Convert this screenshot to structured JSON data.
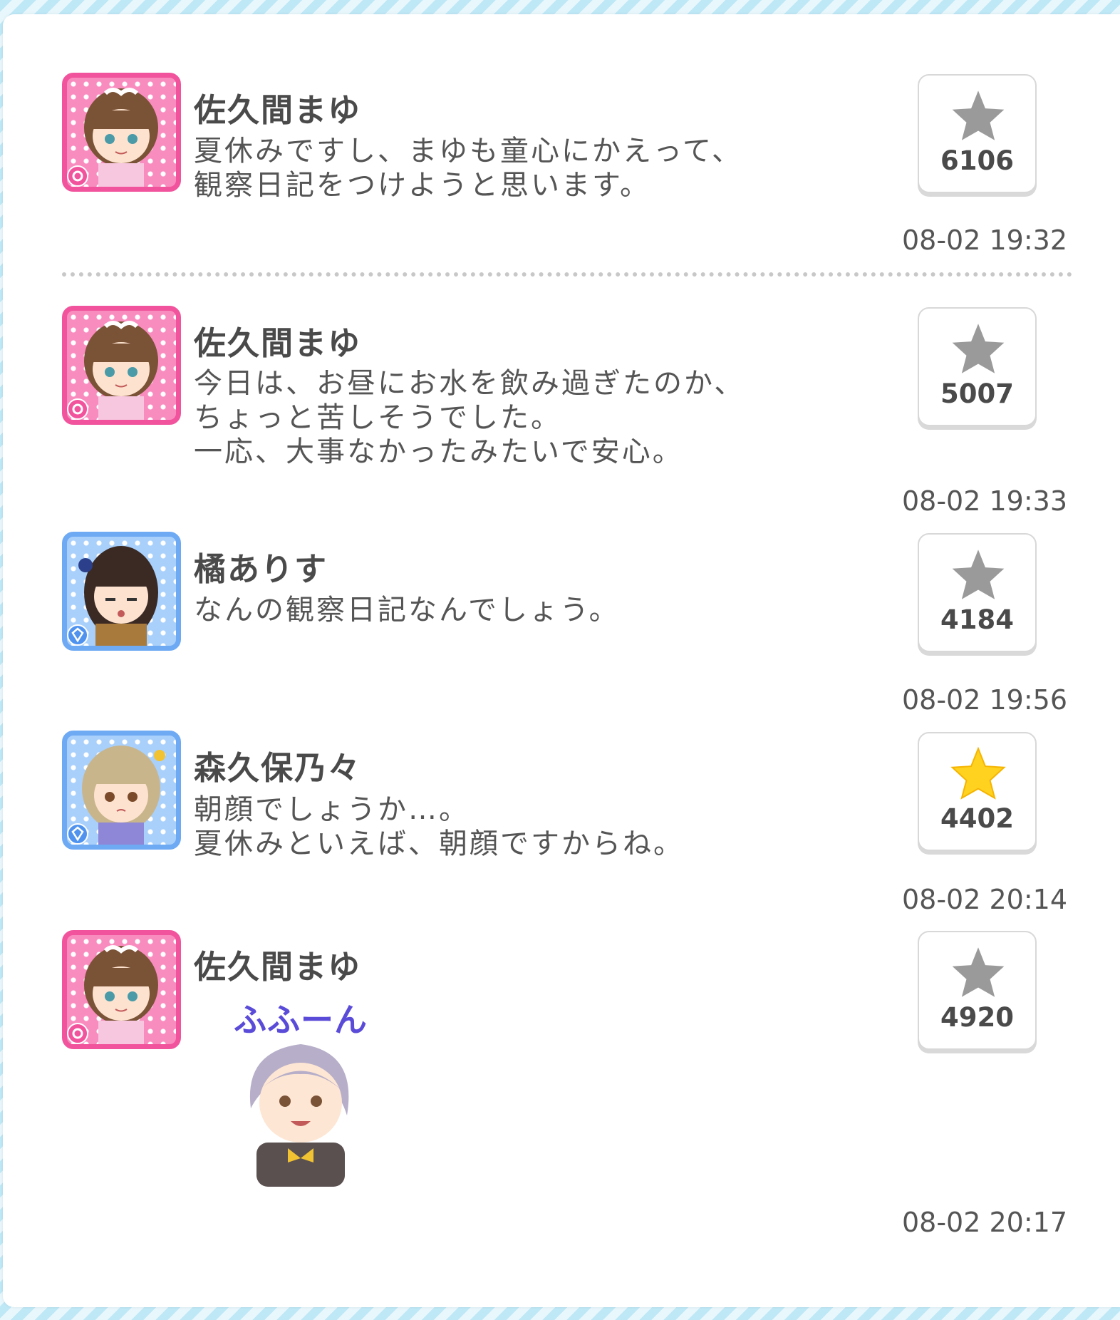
{
  "posts": [
    {
      "author": "佐久間まゆ",
      "text": "夏休みですし、まゆも童心にかえって、\n観察日記をつけようと思います。",
      "likes": "6106",
      "liked": false,
      "timestamp": "08-02 19:32",
      "avatar_theme": "pink"
    },
    {
      "author": "佐久間まゆ",
      "text": "今日は、お昼にお水を飲み過ぎたのか、\nちょっと苦しそうでした。\n一応、大事なかったみたいで安心。",
      "likes": "5007",
      "liked": false,
      "timestamp": "08-02 19:33",
      "avatar_theme": "pink"
    },
    {
      "author": "橘ありす",
      "text": "なんの観察日記なんでしょう。",
      "likes": "4184",
      "liked": false,
      "timestamp": "08-02 19:56",
      "avatar_theme": "blue"
    },
    {
      "author": "森久保乃々",
      "text": "朝顔でしょうか…。\n夏休みといえば、朝顔ですからね。",
      "likes": "4402",
      "liked": true,
      "timestamp": "08-02 20:14",
      "avatar_theme": "blue"
    },
    {
      "author": "佐久間まゆ",
      "sticker_text": "ふふーん",
      "likes": "4920",
      "liked": false,
      "timestamp": "08-02 20:17",
      "avatar_theme": "pink"
    }
  ],
  "icons": {
    "like": "star-icon",
    "cute_type": "flower-badge-icon",
    "cool_type": "diamond-badge-icon"
  },
  "colors": {
    "star_inactive": "#9a9a9a",
    "star_active": "#ffd21f",
    "pink_frame": "#f1549c",
    "blue_frame": "#6ea9f4"
  }
}
